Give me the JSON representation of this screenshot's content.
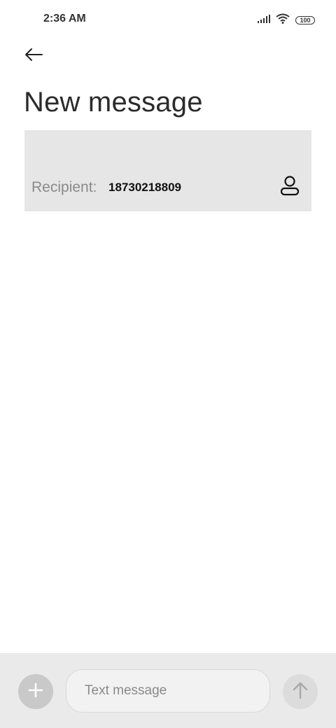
{
  "status_bar": {
    "time": "2:36 AM",
    "battery": "100",
    "icons": [
      "signal-icon",
      "wifi-icon",
      "battery-icon"
    ]
  },
  "header": {
    "back_icon": "arrow-left-icon",
    "title": "New message"
  },
  "recipient": {
    "label": "Recipient:",
    "value": "18730218809",
    "contact_icon": "person-icon"
  },
  "composer": {
    "add_icon": "plus-icon",
    "placeholder": "Text message",
    "send_icon": "arrow-up-icon"
  },
  "colors": {
    "recipient_bg": "#e6e6e6",
    "bottom_bar_bg": "#eaeaea"
  }
}
